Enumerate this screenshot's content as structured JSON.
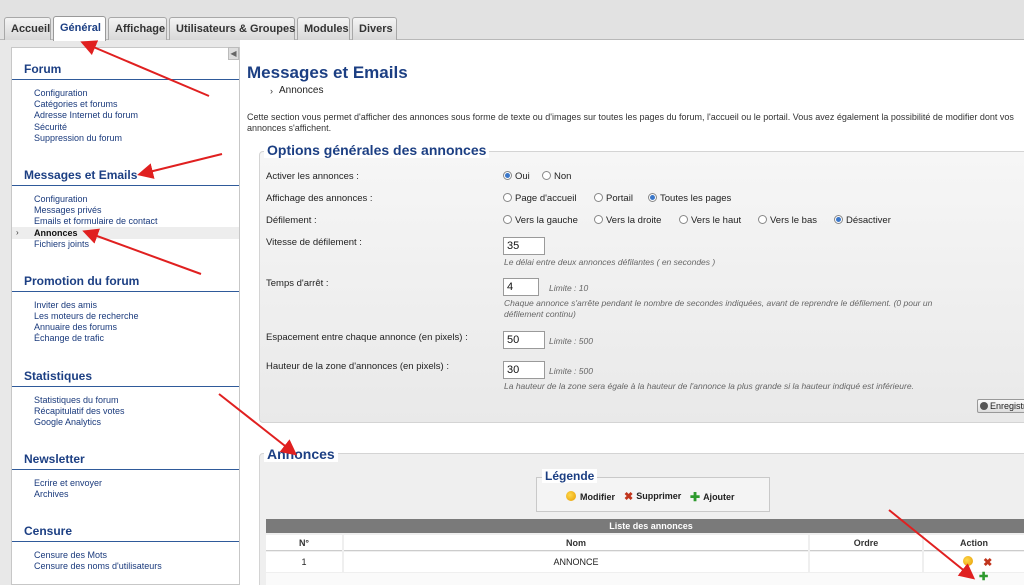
{
  "tabs": [
    "Accueil",
    "Général",
    "Affichage",
    "Utilisateurs & Groupes",
    "Modules",
    "Divers"
  ],
  "sidebar": {
    "collapse_glyph": "◀",
    "sections": [
      {
        "title": "Forum",
        "items": [
          "Configuration",
          "Catégories et forums",
          "Adresse Internet du forum",
          "Sécurité",
          "Suppression du forum"
        ]
      },
      {
        "title": "Messages et Emails",
        "items": [
          "Configuration",
          "Messages privés",
          "Emails et formulaire de contact",
          "Annonces",
          "Fichiers joints"
        ],
        "active_item": "Annonces"
      },
      {
        "title": "Promotion du forum",
        "items": [
          "Inviter des amis",
          "Les moteurs de recherche",
          "Annuaire des forums",
          "Échange de trafic"
        ]
      },
      {
        "title": "Statistiques",
        "items": [
          "Statistiques du forum",
          "Récapitulatif des votes",
          "Google Analytics"
        ]
      },
      {
        "title": "Newsletter",
        "items": [
          "Ecrire et envoyer",
          "Archives"
        ]
      },
      {
        "title": "Censure",
        "items": [
          "Censure des Mots",
          "Censure des noms d'utilisateurs"
        ]
      }
    ]
  },
  "main": {
    "title": "Messages et Emails",
    "breadcrumb": "Annonces",
    "description": "Cette section vous permet d'afficher des annonces sous forme de texte ou d'images sur toutes les pages du forum, l'accueil ou le portail. Vous avez également la possibilité de modifier dont vos annonces s'affichent.",
    "options": {
      "legend": "Options générales des annonces",
      "activer": {
        "label": "Activer les annonces :",
        "opt_yes": "Oui",
        "opt_no": "Non",
        "selected": "Oui"
      },
      "affichage": {
        "label": "Affichage des annonces :",
        "opt1": "Page d'accueil",
        "opt2": "Portail",
        "opt3": "Toutes les pages",
        "selected": "Toutes les pages"
      },
      "defilement": {
        "label": "Défilement :",
        "opt1": "Vers la gauche",
        "opt2": "Vers la droite",
        "opt3": "Vers le haut",
        "opt4": "Vers le bas",
        "opt5": "Désactiver",
        "selected": "Désactiver"
      },
      "vitesse": {
        "label": "Vitesse de défilement :",
        "value": "35",
        "hint": "Le délai entre deux annonces défilantes ( en secondes )"
      },
      "arret": {
        "label": "Temps d'arrêt :",
        "value": "4",
        "limit": "Limite : 10",
        "hint1": "Chaque annonce s'arrête pendant le nombre de secondes indiquées, avant de reprendre le défilement. (0 pour un",
        "hint2": "défilement continu)"
      },
      "espacement": {
        "label": "Espacement entre chaque annonce (en pixels) :",
        "value": "50",
        "limit": "Limite : 500"
      },
      "hauteur": {
        "label": "Hauteur de la zone d'annonces (en pixels) :",
        "value": "30",
        "limit": "Limite : 500",
        "hint": "La hauteur de la zone sera égale à la hauteur de l'annonce la plus grande si la hauteur indiqué est inférieure."
      },
      "save_label": "Enregistrer"
    },
    "annonces": {
      "legend": "Annonces",
      "legende_title": "Légende",
      "legende_edit": "Modifier",
      "legende_delete": "Supprimer",
      "legende_add": "Ajouter",
      "list_title": "Liste des annonces",
      "columns": {
        "num": "N°",
        "name": "Nom",
        "order": "Ordre",
        "action": "Action"
      },
      "rows": [
        {
          "num": "1",
          "name": "ANNONCE"
        }
      ]
    }
  },
  "colors": {
    "accent": "#1c3f83",
    "arrow": "#e02020"
  }
}
